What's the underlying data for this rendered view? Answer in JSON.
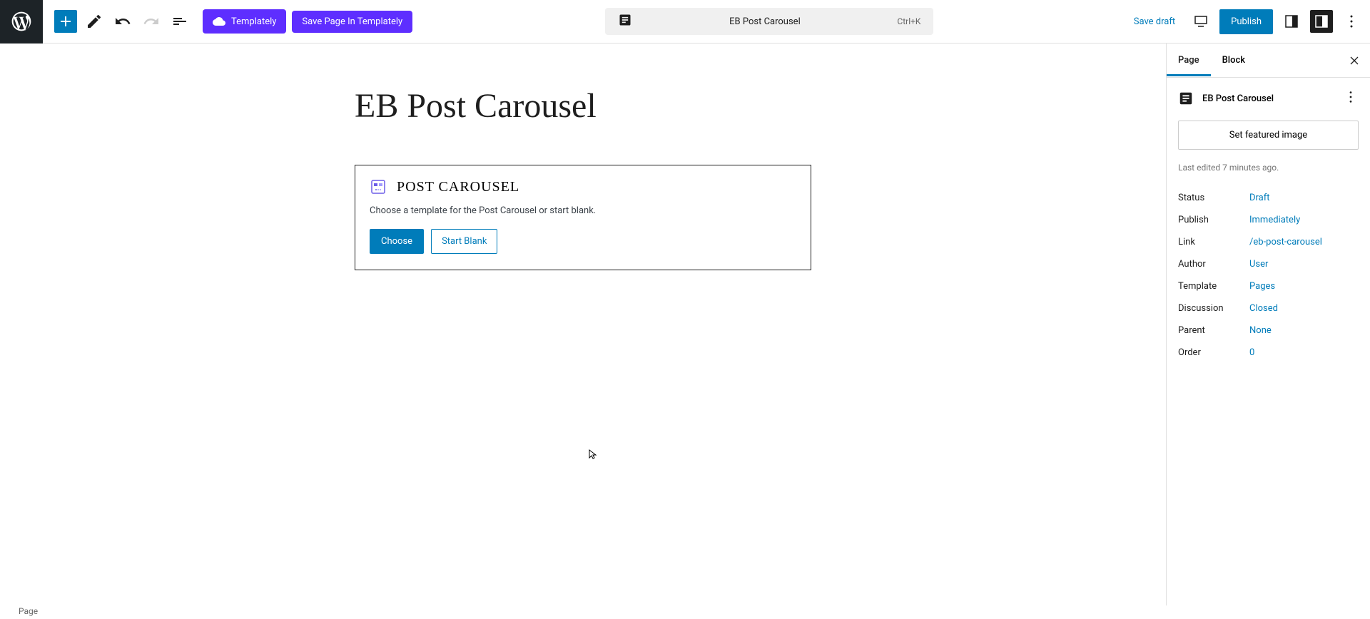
{
  "toolbar": {
    "templately_label": "Templately",
    "save_templately_label": "Save Page In Templately",
    "doc_title": "EB Post Carousel",
    "shortcut": "Ctrl+K",
    "save_draft": "Save draft",
    "publish": "Publish"
  },
  "content": {
    "page_title": "EB Post Carousel",
    "block_name": "POST CAROUSEL",
    "block_desc": "Choose a template for the Post Carousel or start blank.",
    "choose_btn": "Choose",
    "blank_btn": "Start Blank"
  },
  "sidebar": {
    "tabs": {
      "page": "Page",
      "block": "Block"
    },
    "doc_title": "EB Post Carousel",
    "featured_btn": "Set featured image",
    "last_edited": "Last edited 7 minutes ago.",
    "props": [
      {
        "label": "Status",
        "value": "Draft"
      },
      {
        "label": "Publish",
        "value": "Immediately"
      },
      {
        "label": "Link",
        "value": "/eb-post-carousel"
      },
      {
        "label": "Author",
        "value": "User"
      },
      {
        "label": "Template",
        "value": "Pages"
      },
      {
        "label": "Discussion",
        "value": "Closed"
      },
      {
        "label": "Parent",
        "value": "None"
      },
      {
        "label": "Order",
        "value": "0"
      }
    ]
  },
  "footer": {
    "breadcrumb": "Page"
  }
}
